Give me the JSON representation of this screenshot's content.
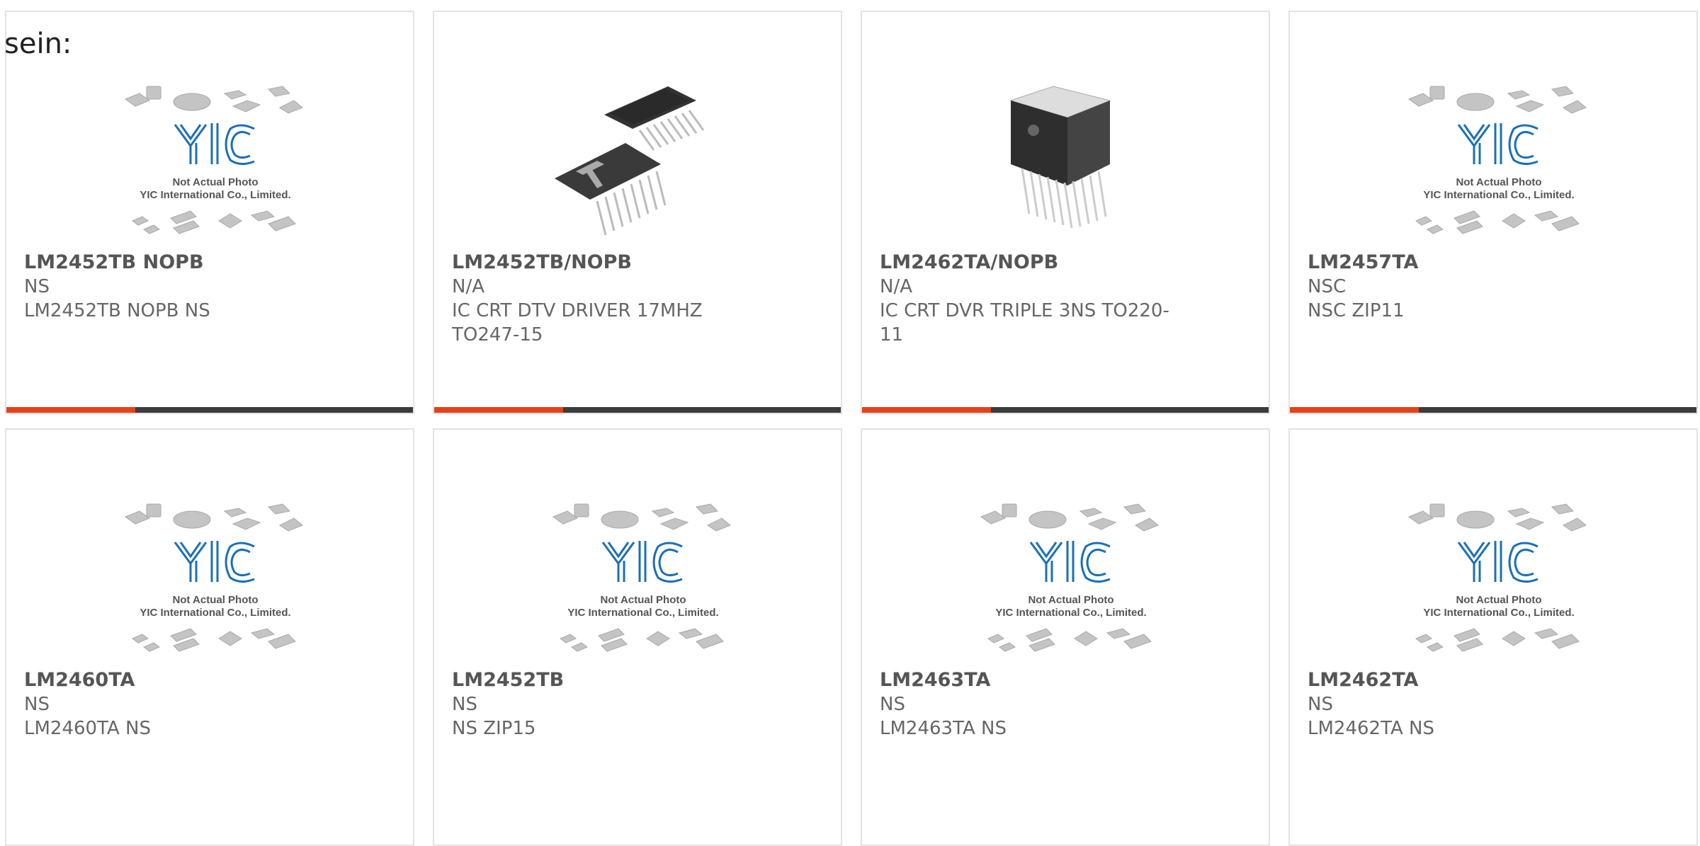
{
  "lead_text": "sein:",
  "placeholder": {
    "brand": "YIC",
    "line1": "Not Actual Photo",
    "line2": "YIC International Co., Limited."
  },
  "colors": {
    "accent": "#e8411a",
    "bar": "#3c3c3c",
    "logo": "#1a6fb8",
    "border": "#e3e3e3"
  },
  "products": [
    {
      "part_number": "LM2452TB NOPB",
      "manufacturer": "NS",
      "description": "LM2452TB NOPB NS",
      "image": "placeholder"
    },
    {
      "part_number": "LM2452TB/NOPB",
      "manufacturer": "N/A",
      "description": "IC CRT DTV DRIVER 17MHZ TO247-15",
      "image": "ic-photo-to247"
    },
    {
      "part_number": "LM2462TA/NOPB",
      "manufacturer": "N/A",
      "description": "IC CRT DVR TRIPLE 3NS TO220-11",
      "image": "ic-photo-to220"
    },
    {
      "part_number": "LM2457TA",
      "manufacturer": "NSC",
      "description": "NSC ZIP11",
      "image": "placeholder"
    },
    {
      "part_number": "LM2460TA",
      "manufacturer": "NS",
      "description": "LM2460TA NS",
      "image": "placeholder"
    },
    {
      "part_number": "LM2452TB",
      "manufacturer": "NS",
      "description": "NS ZIP15",
      "image": "placeholder"
    },
    {
      "part_number": "LM2463TA",
      "manufacturer": "NS",
      "description": "LM2463TA NS",
      "image": "placeholder"
    },
    {
      "part_number": "LM2462TA",
      "manufacturer": "NS",
      "description": "LM2462TA NS",
      "image": "placeholder"
    }
  ]
}
